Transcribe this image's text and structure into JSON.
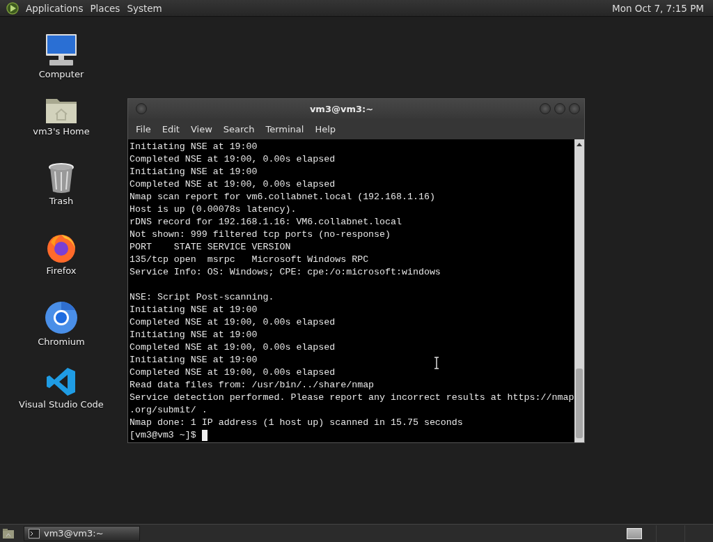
{
  "top_panel": {
    "menus": [
      "Applications",
      "Places",
      "System"
    ],
    "clock": "Mon Oct 7, 7:15 PM"
  },
  "desktop_icons": [
    {
      "label": "Computer",
      "kind": "computer"
    },
    {
      "label": "vm3's Home",
      "kind": "home"
    },
    {
      "label": "Trash",
      "kind": "trash"
    },
    {
      "label": "Firefox",
      "kind": "firefox"
    },
    {
      "label": "Chromium",
      "kind": "chromium"
    },
    {
      "label": "Visual Studio Code",
      "kind": "vscode"
    }
  ],
  "terminal": {
    "title": "vm3@vm3:~",
    "menu": [
      "File",
      "Edit",
      "View",
      "Search",
      "Terminal",
      "Help"
    ],
    "sections": [
      [
        "Initiating NSE at 19:00",
        "Completed NSE at 19:00, 0.00s elapsed",
        "Initiating NSE at 19:00",
        "Completed NSE at 19:00, 0.00s elapsed",
        "Nmap scan report for vm6.collabnet.local (192.168.1.16)",
        "Host is up (0.00078s latency).",
        "rDNS record for 192.168.1.16: VM6.collabnet.local",
        "Not shown: 999 filtered tcp ports (no-response)",
        "PORT    STATE SERVICE VERSION",
        "135/tcp open  msrpc   Microsoft Windows RPC",
        "Service Info: OS: Windows; CPE: cpe:/o:microsoft:windows"
      ],
      [
        "NSE: Script Post-scanning.",
        "Initiating NSE at 19:00",
        "Completed NSE at 19:00, 0.00s elapsed",
        "Initiating NSE at 19:00",
        "Completed NSE at 19:00, 0.00s elapsed",
        "Initiating NSE at 19:00",
        "Completed NSE at 19:00, 0.00s elapsed",
        "Read data files from: /usr/bin/../share/nmap",
        "Service detection performed. Please report any incorrect results at https://nmap",
        ".org/submit/ .",
        "Nmap done: 1 IP address (1 host up) scanned in 15.75 seconds"
      ]
    ],
    "prompt": "[vm3@vm3 ~]$"
  },
  "taskbar": {
    "tasks": [
      {
        "label": "vm3@vm3:~",
        "selected": true
      }
    ]
  }
}
